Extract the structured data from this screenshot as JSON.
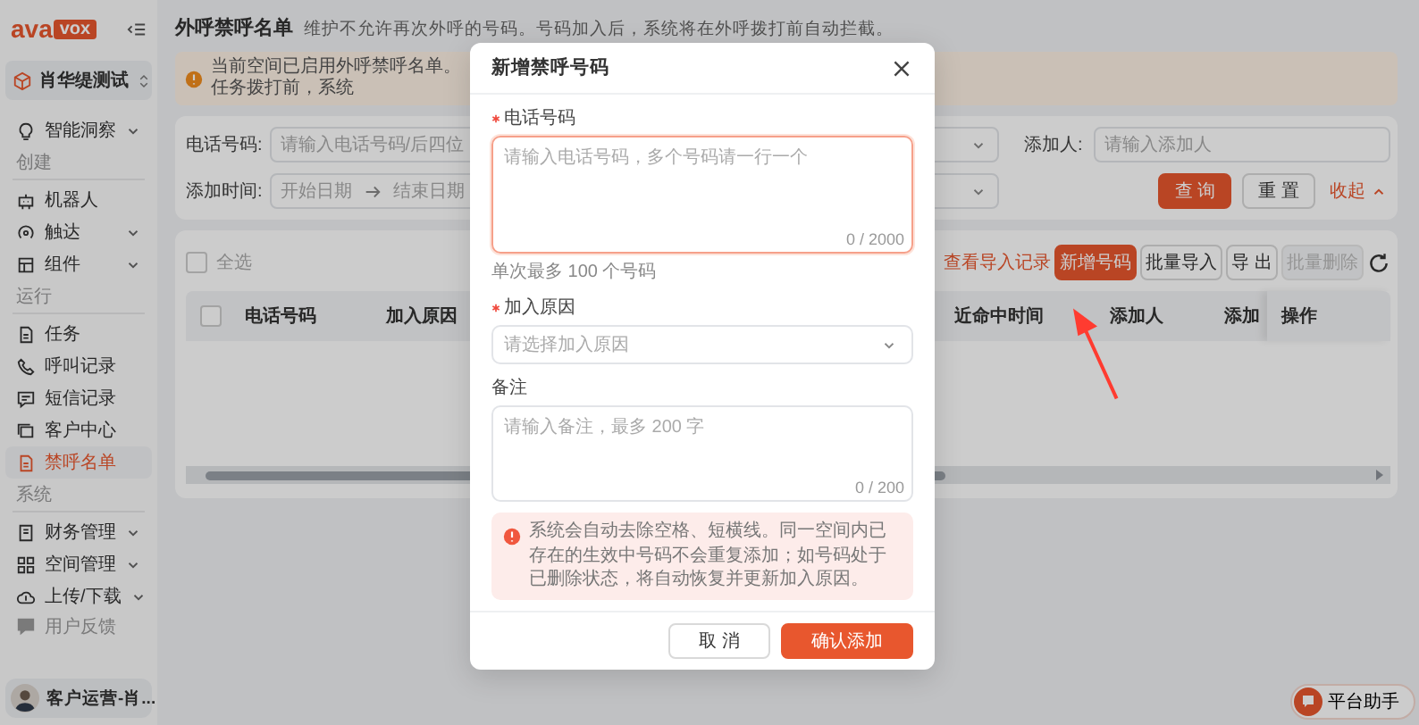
{
  "sidebar": {
    "logo": {
      "text": "ava",
      "badge": "vox"
    },
    "workspace": "肖华缇测试",
    "items": [
      {
        "kind": "item",
        "label": "智能洞察",
        "expandable": true,
        "selected": false
      },
      {
        "kind": "section",
        "label": "创建"
      },
      {
        "kind": "item",
        "label": "机器人",
        "expandable": false,
        "selected": false
      },
      {
        "kind": "item",
        "label": "触达",
        "expandable": true,
        "selected": false
      },
      {
        "kind": "item",
        "label": "组件",
        "expandable": true,
        "selected": false
      },
      {
        "kind": "section",
        "label": "运行"
      },
      {
        "kind": "item",
        "label": "任务",
        "expandable": false,
        "selected": false
      },
      {
        "kind": "item",
        "label": "呼叫记录",
        "expandable": false,
        "selected": false
      },
      {
        "kind": "item",
        "label": "短信记录",
        "expandable": false,
        "selected": false
      },
      {
        "kind": "item",
        "label": "客户中心",
        "expandable": false,
        "selected": false
      },
      {
        "kind": "item",
        "label": "禁呼名单",
        "expandable": false,
        "selected": true
      },
      {
        "kind": "section",
        "label": "系统"
      },
      {
        "kind": "item",
        "label": "财务管理",
        "expandable": true,
        "selected": false
      },
      {
        "kind": "item",
        "label": "空间管理",
        "expandable": true,
        "selected": false
      },
      {
        "kind": "item",
        "label": "上传/下载",
        "expandable": true,
        "selected": false
      },
      {
        "kind": "minor",
        "label": "用户反馈",
        "expandable": false,
        "selected": false
      }
    ],
    "user": "客户运营-肖..."
  },
  "header": {
    "title": "外呼禁呼名单",
    "description": "维护不允许再次外呼的号码。号码加入后，系统将在外呼拨打前自动拦截。"
  },
  "alert": "当前空间已启用外呼禁呼名单。任务拨打前，系统",
  "filters": {
    "phone": {
      "label": "电话号码:",
      "placeholder": "请输入电话号码/后四位"
    },
    "adder": {
      "label": "添加人:",
      "placeholder": "请输入添加人"
    },
    "date": {
      "label": "添加时间:",
      "start": "开始日期",
      "end": "结束日期"
    },
    "buttons": [
      {
        "label": "查 询",
        "kind": "primary"
      },
      {
        "label": "重 置",
        "kind": "default"
      },
      {
        "label": "收起",
        "kind": "link"
      }
    ]
  },
  "toolbar": {
    "select_all": {
      "label": "全选",
      "checked": false
    },
    "buttons": [
      {
        "label": "查看导入记录",
        "kind": "link",
        "disabled": false
      },
      {
        "label": "新增号码",
        "kind": "primary",
        "disabled": false
      },
      {
        "label": "批量导入",
        "kind": "default",
        "disabled": false
      },
      {
        "label": "导 出",
        "kind": "default",
        "disabled": false
      },
      {
        "label": "批量删除",
        "kind": "default",
        "disabled": true
      }
    ]
  },
  "table": {
    "all_checked": false,
    "columns": [
      "电话号码",
      "加入原因",
      "近命中时间",
      "添加人",
      "添加",
      "操作"
    ]
  },
  "modal": {
    "title": "新增禁呼号码",
    "fields": [
      {
        "kind": "textarea",
        "label": "电话号码",
        "required": true,
        "placeholder": "请输入电话号码，多个号码请一行一个",
        "counter": "0 / 2000",
        "hint": "单次最多 100 个号码",
        "focused": true
      },
      {
        "kind": "select",
        "label": "加入原因",
        "required": true,
        "placeholder": "请选择加入原因"
      },
      {
        "kind": "textarea",
        "label": "备注",
        "required": false,
        "placeholder": "请输入备注，最多 200 字",
        "counter": "0 / 200",
        "focused": false
      }
    ],
    "notice": "系统会自动去除空格、短横线。同一空间内已存在的生效中号码不会重复添加；如号码处于已删除状态，将自动恢复并更新加入原因。",
    "buttons": [
      {
        "label": "取 消",
        "kind": "default"
      },
      {
        "label": "确认添加",
        "kind": "primary"
      }
    ]
  },
  "assistant": "平台助手"
}
